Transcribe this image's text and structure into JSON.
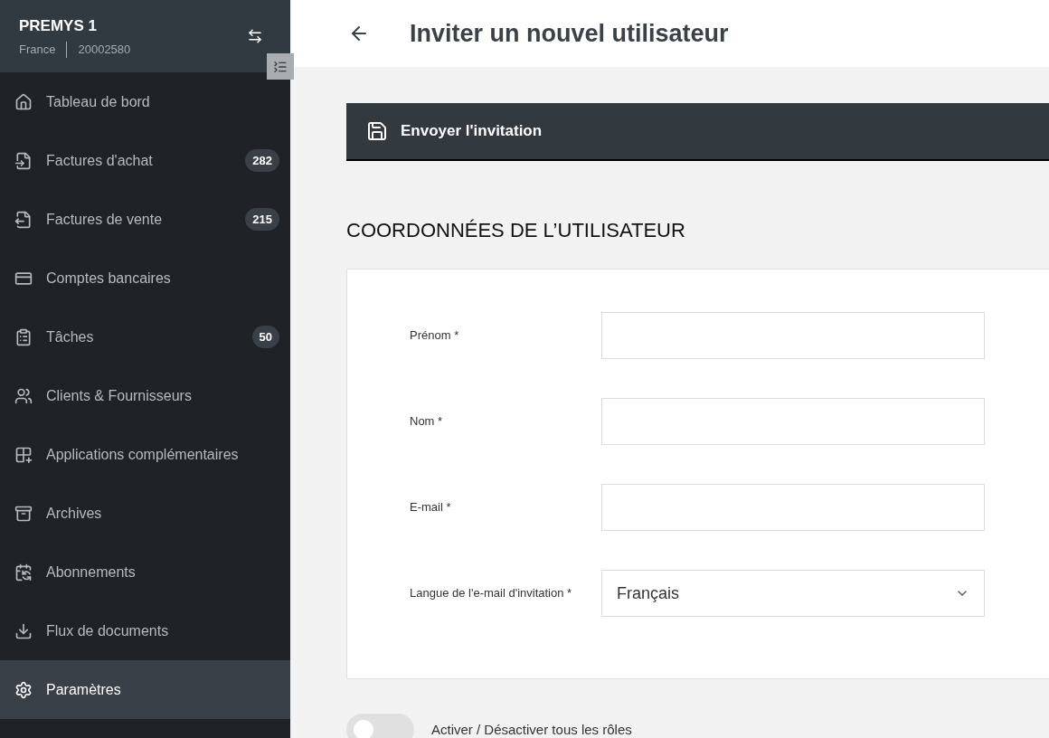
{
  "sidebar": {
    "company": "PREMYS 1",
    "country": "France",
    "number": "20002580",
    "items": [
      {
        "label": "Tableau de bord",
        "selected": false
      },
      {
        "label": "Factures d'achat",
        "badge": "282",
        "selected": false
      },
      {
        "label": "Factures de vente",
        "badge": "215",
        "selected": false
      },
      {
        "label": "Comptes bancaires",
        "selected": false
      },
      {
        "label": "Tâches",
        "badge": "50",
        "selected": false
      },
      {
        "label": "Clients & Fournisseurs",
        "selected": false
      },
      {
        "label": "Applications complémentaires",
        "selected": false
      },
      {
        "label": "Archives",
        "selected": false
      },
      {
        "label": "Abonnements",
        "selected": false
      },
      {
        "label": "Flux de documents",
        "selected": false
      },
      {
        "label": "Paramètres",
        "selected": true
      }
    ]
  },
  "page": {
    "title": "Inviter un nouvel utilisateur",
    "action": "Envoyer l'invitation",
    "section": "COORDONNÉES DE L’UTILISATEUR",
    "fields": [
      {
        "kind": "text",
        "label": "Prénom *"
      },
      {
        "kind": "text",
        "label": "Nom *"
      },
      {
        "kind": "text",
        "label": "E-mail *"
      },
      {
        "kind": "select",
        "label": "Langue de l'e-mail d'invitation *",
        "value": "Français"
      }
    ],
    "toggle": {
      "label": "Activer / Désactiver tous les rôles",
      "on": false
    }
  }
}
